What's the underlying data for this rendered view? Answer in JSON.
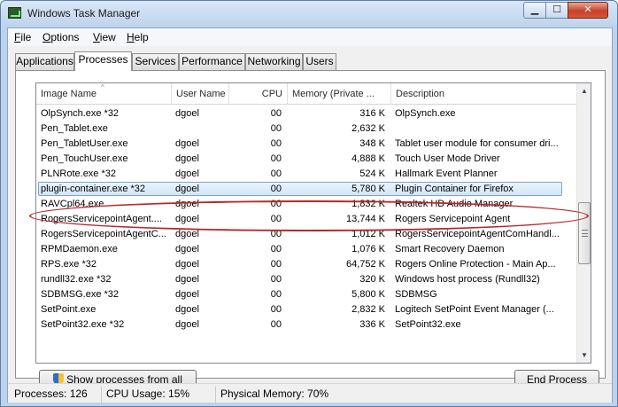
{
  "window": {
    "title": "Windows Task Manager",
    "min": "▁",
    "max": "☐",
    "close": "✕"
  },
  "menu": [
    {
      "key": "F",
      "rest": "ile"
    },
    {
      "key": "O",
      "rest": "ptions"
    },
    {
      "key": "V",
      "rest": "iew"
    },
    {
      "key": "H",
      "rest": "elp"
    }
  ],
  "tabs": [
    "Applications",
    "Processes",
    "Services",
    "Performance",
    "Networking",
    "Users"
  ],
  "active_tab": "Processes",
  "columns": [
    "Image Name",
    "User Name",
    "CPU",
    "Memory (Private ...",
    "Description"
  ],
  "sort_arrow": "^",
  "rows": [
    {
      "name": "OlpSynch.exe *32",
      "user": "dgoel",
      "cpu": "00",
      "mem": "316 K",
      "desc": "OlpSynch.exe"
    },
    {
      "name": "Pen_Tablet.exe",
      "user": "",
      "cpu": "00",
      "mem": "2,632 K",
      "desc": ""
    },
    {
      "name": "Pen_TabletUser.exe",
      "user": "dgoel",
      "cpu": "00",
      "mem": "348 K",
      "desc": "Tablet user module for consumer dri..."
    },
    {
      "name": "Pen_TouchUser.exe",
      "user": "dgoel",
      "cpu": "00",
      "mem": "4,888 K",
      "desc": "Touch User Mode Driver"
    },
    {
      "name": "PLNRote.exe *32",
      "user": "dgoel",
      "cpu": "00",
      "mem": "524 K",
      "desc": "Hallmark Event Planner"
    },
    {
      "name": "plugin-container.exe *32",
      "user": "dgoel",
      "cpu": "00",
      "mem": "5,780 K",
      "desc": "Plugin Container for Firefox"
    },
    {
      "name": "RAVCpl64.exe",
      "user": "dgoel",
      "cpu": "00",
      "mem": "1,832 K",
      "desc": "Realtek HD Audio Manager"
    },
    {
      "name": "RogersServicepointAgent....",
      "user": "dgoel",
      "cpu": "00",
      "mem": "13,744 K",
      "desc": "Rogers Servicepoint Agent"
    },
    {
      "name": "RogersServicepointAgentC...",
      "user": "dgoel",
      "cpu": "00",
      "mem": "1,012 K",
      "desc": "RogersServicepointAgentComHandl..."
    },
    {
      "name": "RPMDaemon.exe",
      "user": "dgoel",
      "cpu": "00",
      "mem": "1,076 K",
      "desc": "Smart Recovery Daemon"
    },
    {
      "name": "RPS.exe *32",
      "user": "dgoel",
      "cpu": "00",
      "mem": "64,752 K",
      "desc": "Rogers Online Protection - Main Ap..."
    },
    {
      "name": "rundll32.exe *32",
      "user": "dgoel",
      "cpu": "00",
      "mem": "320 K",
      "desc": "Windows host process (Rundll32)"
    },
    {
      "name": "SDBMSG.exe *32",
      "user": "dgoel",
      "cpu": "00",
      "mem": "5,800 K",
      "desc": "SDBMSG"
    },
    {
      "name": "SetPoint.exe",
      "user": "dgoel",
      "cpu": "00",
      "mem": "2,832 K",
      "desc": "Logitech SetPoint Event Manager (..."
    },
    {
      "name": "SetPoint32.exe *32",
      "user": "dgoel",
      "cpu": "00",
      "mem": "336 K",
      "desc": "SetPoint32.exe"
    }
  ],
  "selected_row": 5,
  "scrollbar": {
    "up": "▲",
    "down": "▼"
  },
  "buttons": {
    "show_all": "Show processes from all users",
    "end_process": "End Process"
  },
  "status": {
    "processes": "Processes: 126",
    "cpu": "CPU Usage: 15%",
    "memory": "Physical Memory: 70%"
  },
  "colors": {
    "selection_border": "#7da2ce",
    "annotation_oval": "#b52a2a"
  }
}
